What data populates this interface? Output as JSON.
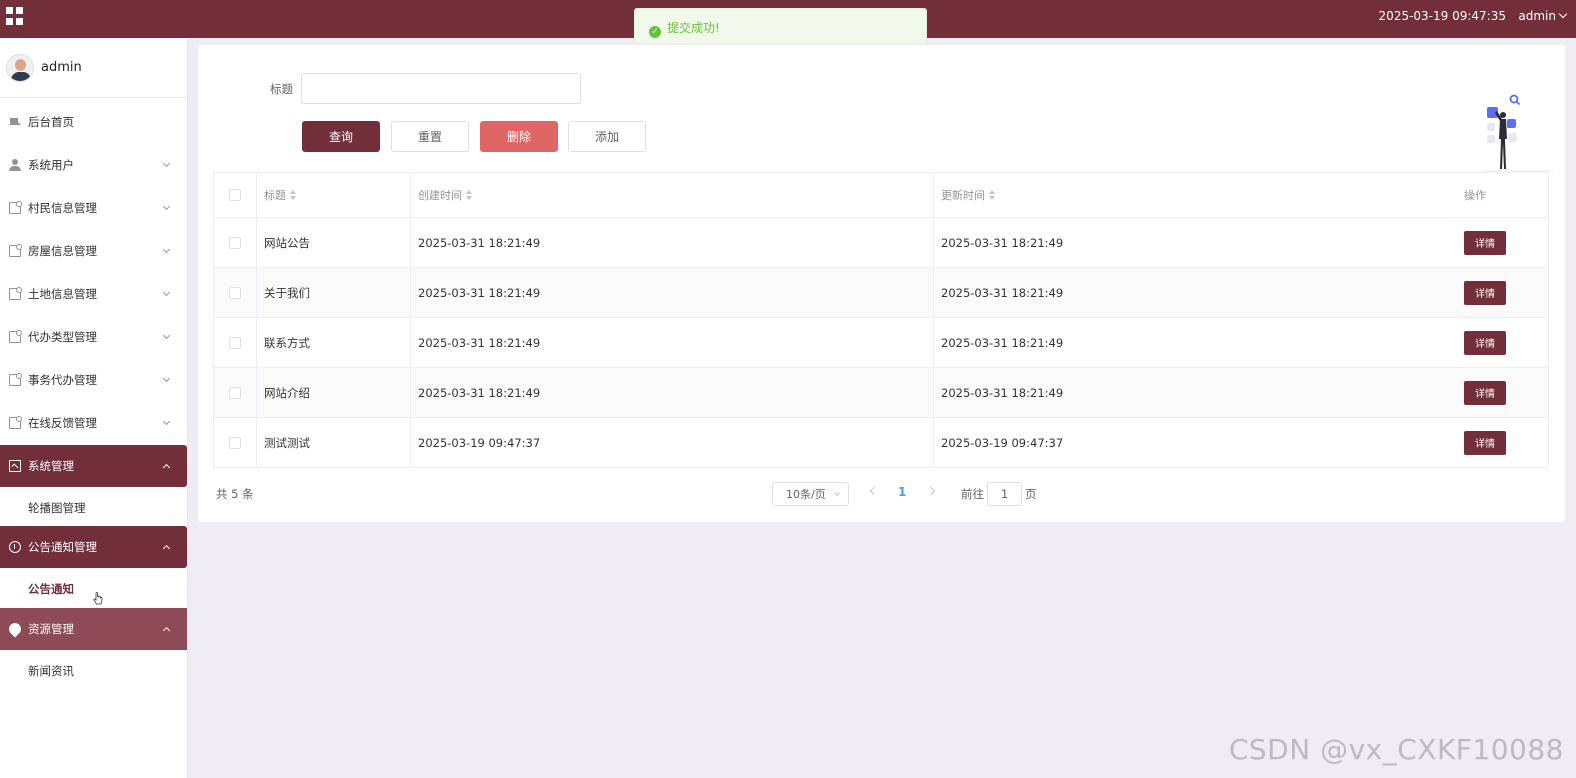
{
  "topbar": {
    "datetime": "2025-03-19 09:47:35",
    "user": "admin"
  },
  "toast": {
    "message": "提交成功!",
    "color": "#67c23a"
  },
  "sidebar": {
    "profile_name": "admin",
    "menu": [
      {
        "label": "后台首页",
        "icon": "home-icon"
      },
      {
        "label": "系统用户",
        "icon": "user-icon"
      },
      {
        "label": "村民信息管理",
        "icon": "doc-icon"
      },
      {
        "label": "房屋信息管理",
        "icon": "doc-icon"
      },
      {
        "label": "土地信息管理",
        "icon": "doc-icon"
      },
      {
        "label": "代办类型管理",
        "icon": "doc-icon"
      },
      {
        "label": "事务代办管理",
        "icon": "doc-icon"
      },
      {
        "label": "在线反馈管理",
        "icon": "doc-icon"
      },
      {
        "label": "系统管理",
        "icon": "picture-icon",
        "expanded": true,
        "children": [
          "轮播图管理"
        ]
      },
      {
        "label": "公告通知管理",
        "icon": "info-icon",
        "expanded": true,
        "children": [
          "公告通知"
        ]
      },
      {
        "label": "资源管理",
        "icon": "location-icon",
        "expanded": true,
        "children": [
          "新闻资讯"
        ]
      }
    ]
  },
  "search": {
    "title_label": "标题",
    "title_value": "",
    "buttons": {
      "query": "查询",
      "reset": "重置",
      "delete": "删除",
      "add": "添加"
    }
  },
  "table": {
    "headers": [
      "标题",
      "创建时间",
      "更新时间",
      "操作"
    ],
    "rows": [
      {
        "title": "网站公告",
        "created": "2025-03-31 18:21:49",
        "updated": "2025-03-31 18:21:49",
        "action": "详情"
      },
      {
        "title": "关于我们",
        "created": "2025-03-31 18:21:49",
        "updated": "2025-03-31 18:21:49",
        "action": "详情"
      },
      {
        "title": "联系方式",
        "created": "2025-03-31 18:21:49",
        "updated": "2025-03-31 18:21:49",
        "action": "详情"
      },
      {
        "title": "网站介绍",
        "created": "2025-03-31 18:21:49",
        "updated": "2025-03-31 18:21:49",
        "action": "详情"
      },
      {
        "title": "测试测试",
        "created": "2025-03-19 09:47:37",
        "updated": "2025-03-19 09:47:37",
        "action": "详情"
      }
    ]
  },
  "pagination": {
    "total": "共 5 条",
    "page_size": "10条/页",
    "current_page": "1",
    "goto_label": "前往",
    "goto_value": "1",
    "goto_suffix": "页"
  },
  "watermark": "CSDN @vx_CXKF10088",
  "colors": {
    "primary": "#722f3a",
    "danger": "#e06666",
    "resource_menu": "#8d4a57",
    "page_active": "#409eff"
  }
}
